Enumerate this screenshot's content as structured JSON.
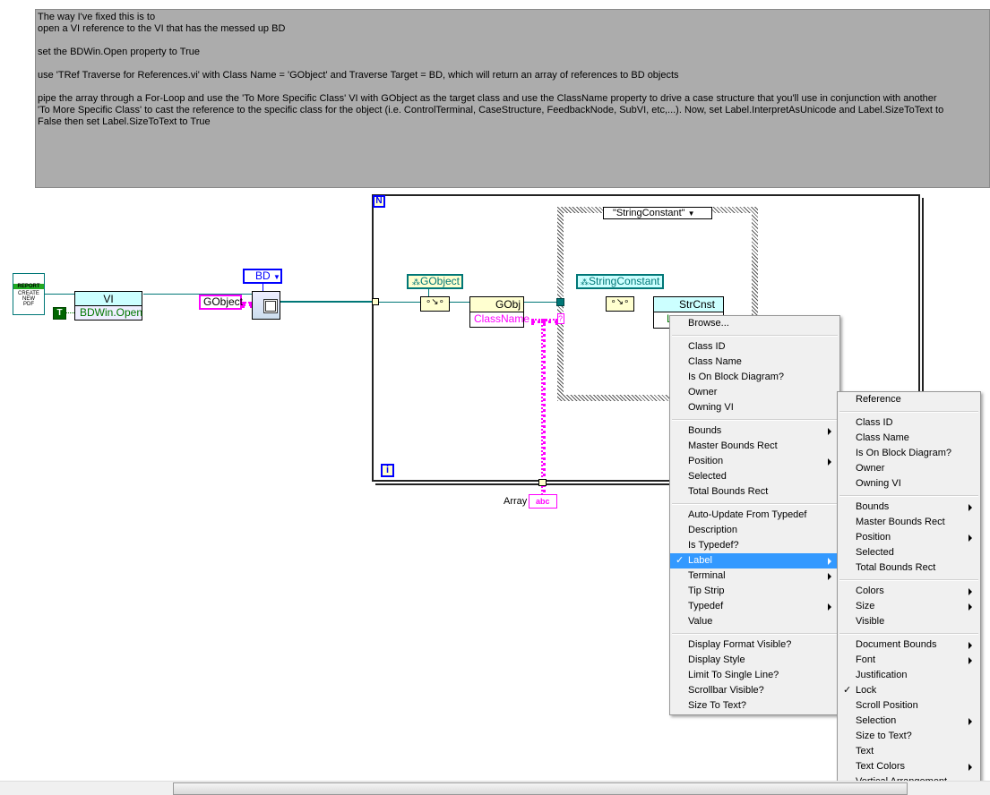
{
  "comment": {
    "lines": [
      "The way I've fixed this is to",
      "open a VI reference to the VI that has the messed up BD",
      "",
      "set the BDWin.Open property to True",
      "",
      "use 'TRef Traverse for References.vi' with Class Name = 'GObject' and Traverse Target = BD, which will return an array of references to BD objects",
      "",
      "pipe the array through a For-Loop and use the 'To More Specific Class' VI with GObject as the target class and use the ClassName property to drive a case structure that you'll use in conjunction with another",
      "'To More Specific Class' to cast the reference to the specific class for the object (i.e. ControlTerminal, CaseStructure, FeedbackNode, SubVI, etc,...). Now, set Label.InterpretAsUnicode and Label.SizeToText to",
      "False then set Label.SizeToText to True"
    ]
  },
  "diagram": {
    "report_icon": {
      "title": "REPORT",
      "lines": "CREATE NEW PDF"
    },
    "property_node_vi": {
      "class": "VI",
      "property": "BDWin.Open"
    },
    "bool_constant": "T",
    "gobject_string": "GObject",
    "traverse_target": "BD",
    "loop_count": "N",
    "loop_index": "i",
    "class_constant_gobject": "GObject",
    "property_node_gobj": {
      "class": "GObj",
      "property": "ClassName"
    },
    "case_selector": "\"StringConstant\"",
    "class_constant_strconst": "StringConstant",
    "property_node_strcnst": {
      "class": "StrCnst",
      "property": "L"
    },
    "array_label": "Array",
    "array_indicator": "abc"
  },
  "menu1": {
    "groups": [
      [
        {
          "label": "Browse..."
        }
      ],
      [
        {
          "label": "Class ID"
        },
        {
          "label": "Class Name"
        },
        {
          "label": "Is On Block Diagram?"
        },
        {
          "label": "Owner"
        },
        {
          "label": "Owning VI"
        }
      ],
      [
        {
          "label": "Bounds",
          "sub": true
        },
        {
          "label": "Master Bounds Rect"
        },
        {
          "label": "Position",
          "sub": true
        },
        {
          "label": "Selected"
        },
        {
          "label": "Total Bounds Rect"
        }
      ],
      [
        {
          "label": "Auto-Update From Typedef"
        },
        {
          "label": "Description"
        },
        {
          "label": "Is Typedef?"
        },
        {
          "label": "Label",
          "sub": true,
          "checked": true,
          "highlighted": true
        },
        {
          "label": "Terminal",
          "sub": true
        },
        {
          "label": "Tip Strip"
        },
        {
          "label": "Typedef",
          "sub": true
        },
        {
          "label": "Value"
        }
      ],
      [
        {
          "label": "Display Format Visible?"
        },
        {
          "label": "Display Style"
        },
        {
          "label": "Limit To Single Line?"
        },
        {
          "label": "Scrollbar Visible?"
        },
        {
          "label": "Size To Text?"
        }
      ]
    ]
  },
  "menu2": {
    "groups": [
      [
        {
          "label": "Reference"
        }
      ],
      [
        {
          "label": "Class ID"
        },
        {
          "label": "Class Name"
        },
        {
          "label": "Is On Block Diagram?"
        },
        {
          "label": "Owner"
        },
        {
          "label": "Owning VI"
        }
      ],
      [
        {
          "label": "Bounds",
          "sub": true
        },
        {
          "label": "Master Bounds Rect"
        },
        {
          "label": "Position",
          "sub": true
        },
        {
          "label": "Selected"
        },
        {
          "label": "Total Bounds Rect"
        }
      ],
      [
        {
          "label": "Colors",
          "sub": true
        },
        {
          "label": "Size",
          "sub": true
        },
        {
          "label": "Visible"
        }
      ],
      [
        {
          "label": "Document Bounds",
          "sub": true
        },
        {
          "label": "Font",
          "sub": true
        },
        {
          "label": "Justification"
        },
        {
          "label": "Lock",
          "checked": true
        },
        {
          "label": "Scroll Position"
        },
        {
          "label": "Selection",
          "sub": true
        },
        {
          "label": "Size to Text?"
        },
        {
          "label": "Text"
        },
        {
          "label": "Text Colors",
          "sub": true
        },
        {
          "label": "Vertical Arrangement"
        }
      ]
    ]
  },
  "colors": {
    "comment_bg": "#acacac",
    "ref_wire": "#007777",
    "string_wire": "#ff00ff",
    "highlight": "#3399ff"
  }
}
